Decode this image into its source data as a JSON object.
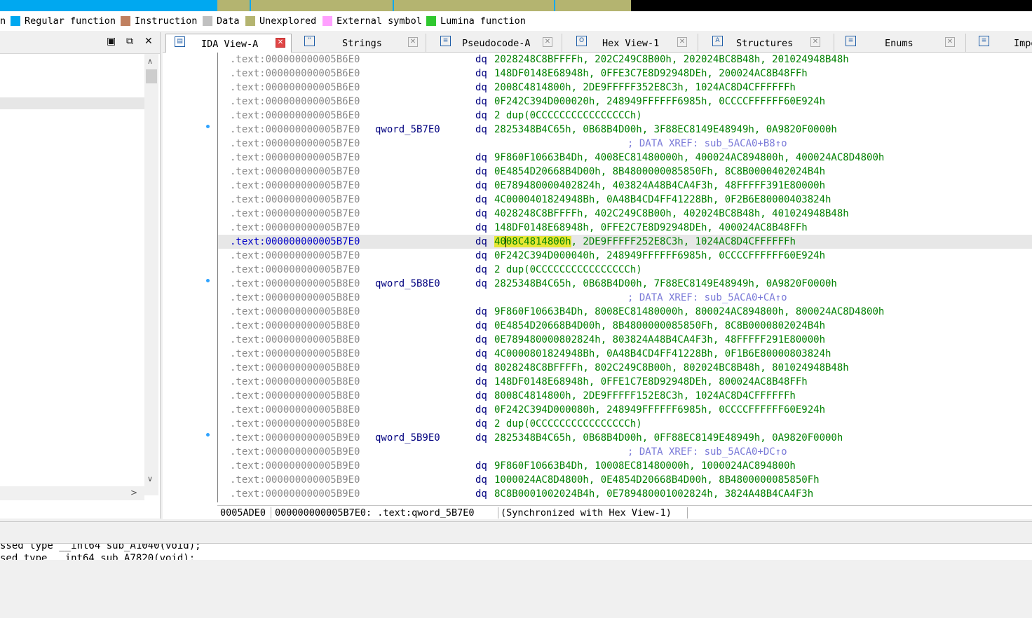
{
  "navigation_band": {
    "colors": [
      "#00a8f0",
      "#b4b470",
      "#000000"
    ]
  },
  "legend": [
    {
      "label": "n",
      "color": "#00a8f0"
    },
    {
      "label": "Regular function",
      "color": "#00a8f0"
    },
    {
      "label": "Instruction",
      "color": "#c08060"
    },
    {
      "label": "Data",
      "color": "#c0c0c0"
    },
    {
      "label": "Unexplored",
      "color": "#b4b470"
    },
    {
      "label": "External symbol",
      "color": "#ffa0ff"
    },
    {
      "label": "Lumina function",
      "color": "#30c830"
    }
  ],
  "left_panel": {
    "minimize_icon": "window-minimize-icon",
    "float_icon": "window-float-icon",
    "close_icon": "window-close-icon"
  },
  "tabs": [
    {
      "label": "IDA View-A",
      "icon": "ida-view-icon",
      "active": true
    },
    {
      "label": "Strings",
      "icon": "strings-icon",
      "active": false
    },
    {
      "label": "Pseudocode-A",
      "icon": "pseudocode-icon",
      "active": false
    },
    {
      "label": "Hex View-1",
      "icon": "hex-view-icon",
      "active": false
    },
    {
      "label": "Structures",
      "icon": "structures-icon",
      "active": false
    },
    {
      "label": "Enums",
      "icon": "enums-icon",
      "active": false
    },
    {
      "label": "Impo",
      "icon": "imports-icon",
      "active": false
    }
  ],
  "listing": [
    {
      "addr": ".text:000000000005B6E0",
      "label": "",
      "mn": "dq",
      "ops": "2028248C8BFFFFh, 202C249C8B00h, 202024BC8B48h, 201024948B48h",
      "comment": ""
    },
    {
      "addr": ".text:000000000005B6E0",
      "label": "",
      "mn": "dq",
      "ops": "148DF0148E68948h, 0FFE3C7E8D92948DEh, 200024AC8B48FFh",
      "comment": ""
    },
    {
      "addr": ".text:000000000005B6E0",
      "label": "",
      "mn": "dq",
      "ops": "2008C4814800h, 2DE9FFFFF352E8C3h, 1024AC8D4CFFFFFFh",
      "comment": ""
    },
    {
      "addr": ".text:000000000005B6E0",
      "label": "",
      "mn": "dq",
      "ops": "0F242C394D000020h, 248949FFFFFF6985h, 0CCCCFFFFFF60E924h",
      "comment": ""
    },
    {
      "addr": ".text:000000000005B6E0",
      "label": "",
      "mn": "dq",
      "ops": "2 dup(0CCCCCCCCCCCCCCCCh)",
      "comment": ""
    },
    {
      "addr": ".text:000000000005B7E0",
      "label": "qword_5B7E0",
      "mn": "dq",
      "ops": "2825348B4C65h, 0B68B4D00h, 3F88EC8149E48949h, 0A9820F0000h",
      "comment": ""
    },
    {
      "addr": ".text:000000000005B7E0",
      "label": "",
      "mn": "",
      "ops": "",
      "comment": "; DATA XREF: sub_5ACA0+B8↑o"
    },
    {
      "addr": ".text:000000000005B7E0",
      "label": "",
      "mn": "dq",
      "ops": "9F860F10663B4Dh, 4008EC81480000h, 400024AC894800h, 400024AC8D4800h",
      "comment": ""
    },
    {
      "addr": ".text:000000000005B7E0",
      "label": "",
      "mn": "dq",
      "ops": "0E4854D20668B4D00h, 8B4800000085850Fh, 8C8B0000402024B4h",
      "comment": ""
    },
    {
      "addr": ".text:000000000005B7E0",
      "label": "",
      "mn": "dq",
      "ops": "0E789480000402824h, 403824A48B4CA4F3h, 48FFFFF391E80000h",
      "comment": ""
    },
    {
      "addr": ".text:000000000005B7E0",
      "label": "",
      "mn": "dq",
      "ops": "4C0000401824948Bh, 0A48B4CD4FF41228Bh, 0F2B6E80000403824h",
      "comment": ""
    },
    {
      "addr": ".text:000000000005B7E0",
      "label": "",
      "mn": "dq",
      "ops": "4028248C8BFFFFh, 402C249C8B00h, 402024BC8B48h, 401024948B48h",
      "comment": ""
    },
    {
      "addr": ".text:000000000005B7E0",
      "label": "",
      "mn": "dq",
      "ops": "148DF0148E68948h, 0FFE2C7E8D92948DEh, 400024AC8B48FFh",
      "comment": ""
    },
    {
      "addr": ".text:000000000005B7E0",
      "label": "",
      "mn": "dq",
      "ops": "",
      "hl_a": "40",
      "hl_b": "08C4814800h",
      "ops_rest": ", 2DE9FFFFF252E8C3h, 1024AC8D4CFFFFFFh",
      "comment": "",
      "current": true
    },
    {
      "addr": ".text:000000000005B7E0",
      "label": "",
      "mn": "dq",
      "ops": "0F242C394D000040h, 248949FFFFFF6985h, 0CCCCFFFFFF60E924h",
      "comment": ""
    },
    {
      "addr": ".text:000000000005B7E0",
      "label": "",
      "mn": "dq",
      "ops": "2 dup(0CCCCCCCCCCCCCCCCh)",
      "comment": ""
    },
    {
      "addr": ".text:000000000005B8E0",
      "label": "qword_5B8E0",
      "mn": "dq",
      "ops": "2825348B4C65h, 0B68B4D00h, 7F88EC8149E48949h, 0A9820F0000h",
      "comment": ""
    },
    {
      "addr": ".text:000000000005B8E0",
      "label": "",
      "mn": "",
      "ops": "",
      "comment": "; DATA XREF: sub_5ACA0+CA↑o"
    },
    {
      "addr": ".text:000000000005B8E0",
      "label": "",
      "mn": "dq",
      "ops": "9F860F10663B4Dh, 8008EC81480000h, 800024AC894800h, 800024AC8D4800h",
      "comment": ""
    },
    {
      "addr": ".text:000000000005B8E0",
      "label": "",
      "mn": "dq",
      "ops": "0E4854D20668B4D00h, 8B4800000085850Fh, 8C8B0000802024B4h",
      "comment": ""
    },
    {
      "addr": ".text:000000000005B8E0",
      "label": "",
      "mn": "dq",
      "ops": "0E789480000802824h, 803824A48B4CA4F3h, 48FFFFF291E80000h",
      "comment": ""
    },
    {
      "addr": ".text:000000000005B8E0",
      "label": "",
      "mn": "dq",
      "ops": "4C0000801824948Bh, 0A48B4CD4FF41228Bh, 0F1B6E80000803824h",
      "comment": ""
    },
    {
      "addr": ".text:000000000005B8E0",
      "label": "",
      "mn": "dq",
      "ops": "8028248C8BFFFFh, 802C249C8B00h, 802024BC8B48h, 801024948B48h",
      "comment": ""
    },
    {
      "addr": ".text:000000000005B8E0",
      "label": "",
      "mn": "dq",
      "ops": "148DF0148E68948h, 0FFE1C7E8D92948DEh, 800024AC8B48FFh",
      "comment": ""
    },
    {
      "addr": ".text:000000000005B8E0",
      "label": "",
      "mn": "dq",
      "ops": "8008C4814800h, 2DE9FFFFF152E8C3h, 1024AC8D4CFFFFFFh",
      "comment": ""
    },
    {
      "addr": ".text:000000000005B8E0",
      "label": "",
      "mn": "dq",
      "ops": "0F242C394D000080h, 248949FFFFFF6985h, 0CCCCFFFFFF60E924h",
      "comment": ""
    },
    {
      "addr": ".text:000000000005B8E0",
      "label": "",
      "mn": "dq",
      "ops": "2 dup(0CCCCCCCCCCCCCCCCh)",
      "comment": ""
    },
    {
      "addr": ".text:000000000005B9E0",
      "label": "qword_5B9E0",
      "mn": "dq",
      "ops": "2825348B4C65h, 0B68B4D00h, 0FF88EC8149E48949h, 0A9820F0000h",
      "comment": ""
    },
    {
      "addr": ".text:000000000005B9E0",
      "label": "",
      "mn": "",
      "ops": "",
      "comment": "; DATA XREF: sub_5ACA0+DC↑o"
    },
    {
      "addr": ".text:000000000005B9E0",
      "label": "",
      "mn": "dq",
      "ops": "9F860F10663B4Dh, 10008EC81480000h, 1000024AC894800h",
      "comment": ""
    },
    {
      "addr": ".text:000000000005B9E0",
      "label": "",
      "mn": "dq",
      "ops": "1000024AC8D4800h, 0E4854D20668B4D00h, 8B4800000085850Fh",
      "comment": ""
    },
    {
      "addr": ".text:000000000005B9E0",
      "label": "",
      "mn": "dq",
      "ops": "8C8B0001002024B4h, 0E789480001002824h, 3824A48B4CA4F3h",
      "comment": ""
    }
  ],
  "status": {
    "offset": "0005ADE0",
    "location": "000000000005B7E0: .text:qword_5B7E0",
    "sync": "(Synchronized with Hex View-1)"
  },
  "output_lines": [
    "ssed type __int64 sub_A1040(void);",
    "sed type __int64 sub_A7820(void);"
  ]
}
